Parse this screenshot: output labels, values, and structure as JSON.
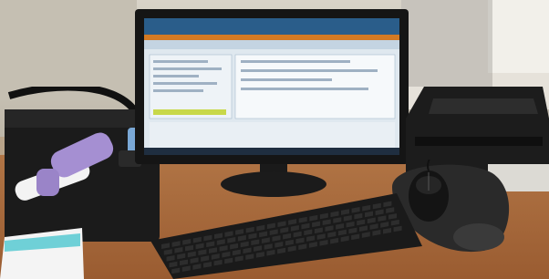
{
  "scene": {
    "description_tags": [
      "desk",
      "monitor",
      "keyboard",
      "mouse",
      "printer",
      "inhaler-device"
    ],
    "colors": {
      "desk": "#a86a3e",
      "wall": "#cfc9bd",
      "floor_tile": "#ddd7cc",
      "monitor_bezel": "#151515",
      "screen_bg": "#dfe8ef",
      "screen_header": "#2a5d8a",
      "screen_accent": "#d37a24",
      "taskbar": "#1f2e40",
      "keyboard": "#1a1a1a",
      "mouse_pad": "#2a2a2a",
      "printer": "#1c1c1c",
      "foam_block": "#1b1b1b",
      "inhaler_purple": "#a58fd2",
      "inhaler_white": "#f3f3f3",
      "paper_teal": "#6fd0d7"
    }
  }
}
